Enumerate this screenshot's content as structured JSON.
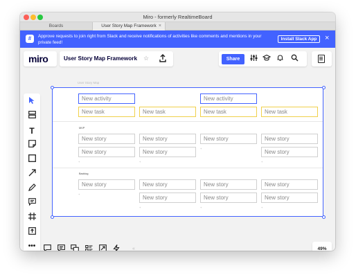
{
  "window": {
    "title": "Miro - formerly RealtimeBoard",
    "tabs": [
      "Boards",
      "User Story Map Framework"
    ],
    "tab_close": "×"
  },
  "banner": {
    "icon": "slack-icon",
    "text": "Approve requests to join right from Slack and receive notifications of activities like comments and mentions in your private feed!",
    "button": "Install Slack App",
    "close": "×"
  },
  "header": {
    "logo": "miro",
    "board_title": "User Story Map Framework",
    "star": "☆",
    "upload": "⇪",
    "share": "Share",
    "icons": [
      "settings-sliders-icon",
      "education-cap-icon",
      "bell-icon",
      "search-icon"
    ]
  },
  "frame": {
    "label": "User Story Map"
  },
  "map": {
    "activities": [
      {
        "label": "New activity"
      },
      {
        "label": "New activity"
      }
    ],
    "tasks": [
      "New task",
      "New task",
      "New task",
      "New task"
    ],
    "releases": [
      {
        "label": "MVP",
        "columns": [
          [
            "New story",
            "New story"
          ],
          [
            "New story",
            "New story"
          ],
          [
            "New story"
          ],
          [
            "New story",
            "New story"
          ]
        ]
      },
      {
        "label": "Backlog",
        "columns": [
          [
            "New story"
          ],
          [
            "New story",
            "New story"
          ],
          [
            "New story",
            "New story"
          ],
          [
            "New story",
            "New story"
          ]
        ]
      }
    ]
  },
  "zoom": "49%",
  "colors": {
    "accent": "#4262ff",
    "task_border": "#f0d04a"
  }
}
